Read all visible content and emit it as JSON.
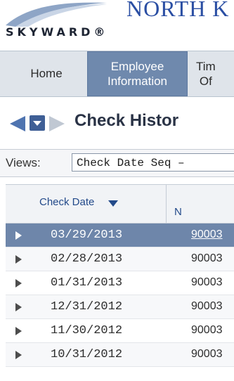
{
  "brand": {
    "logo_text": "SKYWARD®",
    "district_text": "NORTH K"
  },
  "nav": {
    "tabs": [
      {
        "label": "Home"
      },
      {
        "label": "Employee\nInformation"
      },
      {
        "label": "Tim\nOf"
      }
    ]
  },
  "page": {
    "title": "Check Histor"
  },
  "views": {
    "label": "Views:",
    "selected": "Check Date Seq –"
  },
  "grid": {
    "columns": {
      "check_date": "Check Date",
      "number": "N"
    },
    "rows": [
      {
        "date": "03/29/2013",
        "number": "90003"
      },
      {
        "date": "02/28/2013",
        "number": "90003"
      },
      {
        "date": "01/31/2013",
        "number": "90003"
      },
      {
        "date": "12/31/2012",
        "number": "90003"
      },
      {
        "date": "11/30/2012",
        "number": "90003"
      },
      {
        "date": "10/31/2012",
        "number": "90003"
      }
    ]
  },
  "colors": {
    "brand_blue": "#2a4ea3",
    "selected_tab": "#6f89ad",
    "selected_row": "#6e86aa",
    "link_blue": "#234a8a"
  }
}
